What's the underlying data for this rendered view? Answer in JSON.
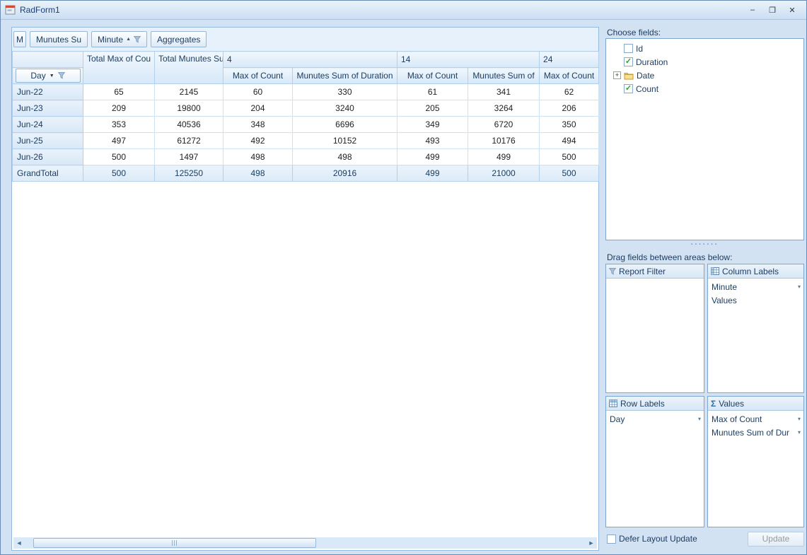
{
  "window": {
    "title": "RadForm1",
    "controls": {
      "minimize": "–",
      "maximize": "❐",
      "close": "✕"
    }
  },
  "pivot": {
    "toolbar": {
      "partial_button": "M",
      "field_button": "Munutes Su",
      "column_button": "Minute",
      "aggregates_button": "Aggregates"
    },
    "row_field_label": "Day",
    "header": {
      "total_columns": [
        "Total Max of Cou",
        "Total Munutes Su"
      ],
      "groups": [
        {
          "label": "4",
          "children": [
            "Max of Count",
            "Munutes Sum of Duration"
          ]
        },
        {
          "label": "14",
          "children": [
            "Max of Count",
            "Munutes Sum of"
          ]
        },
        {
          "label": "24",
          "children": [
            "Max of Count"
          ]
        }
      ]
    },
    "rows": [
      {
        "label": "Jun-22",
        "values": [
          "65",
          "2145",
          "60",
          "330",
          "61",
          "341",
          "62"
        ],
        "is_total": false
      },
      {
        "label": "Jun-23",
        "values": [
          "209",
          "19800",
          "204",
          "3240",
          "205",
          "3264",
          "206"
        ],
        "is_total": false
      },
      {
        "label": "Jun-24",
        "values": [
          "353",
          "40536",
          "348",
          "6696",
          "349",
          "6720",
          "350"
        ],
        "is_total": false
      },
      {
        "label": "Jun-25",
        "values": [
          "497",
          "61272",
          "492",
          "10152",
          "493",
          "10176",
          "494"
        ],
        "is_total": false
      },
      {
        "label": "Jun-26",
        "values": [
          "500",
          "1497",
          "498",
          "498",
          "499",
          "499",
          "500"
        ],
        "is_total": false
      },
      {
        "label": "GrandTotal",
        "values": [
          "500",
          "125250",
          "498",
          "20916",
          "499",
          "21000",
          "500"
        ],
        "is_total": true
      }
    ]
  },
  "field_list": {
    "choose_fields_label": "Choose fields:",
    "fields": [
      {
        "label": "Id",
        "type": "field",
        "checked": false,
        "expandable": false
      },
      {
        "label": "Duration",
        "type": "field",
        "checked": true,
        "expandable": false
      },
      {
        "label": "Date",
        "type": "folder",
        "checked": false,
        "expandable": true
      },
      {
        "label": "Count",
        "type": "field",
        "checked": true,
        "expandable": false
      }
    ],
    "drag_label": "Drag fields between areas below:",
    "areas": {
      "report_filter": {
        "title": "Report Filter",
        "items": []
      },
      "column_labels": {
        "title": "Column Labels",
        "items": [
          {
            "label": "Minute",
            "dropdown": true
          },
          {
            "label": "Values",
            "dropdown": false
          }
        ]
      },
      "row_labels": {
        "title": "Row Labels",
        "items": [
          {
            "label": "Day",
            "dropdown": true
          }
        ]
      },
      "values": {
        "title": "Values",
        "items": [
          {
            "label": "Max of Count",
            "dropdown": true
          },
          {
            "label": "Munutes Sum of Dur",
            "dropdown": true
          }
        ]
      }
    },
    "defer_label": "Defer Layout Update",
    "update_button": "Update"
  },
  "colors": {
    "titlebar_text": "#1c3f77",
    "panel_border": "#96b9dc",
    "header_fill": "#dcebfa",
    "checked_green": "#2ca02c"
  }
}
